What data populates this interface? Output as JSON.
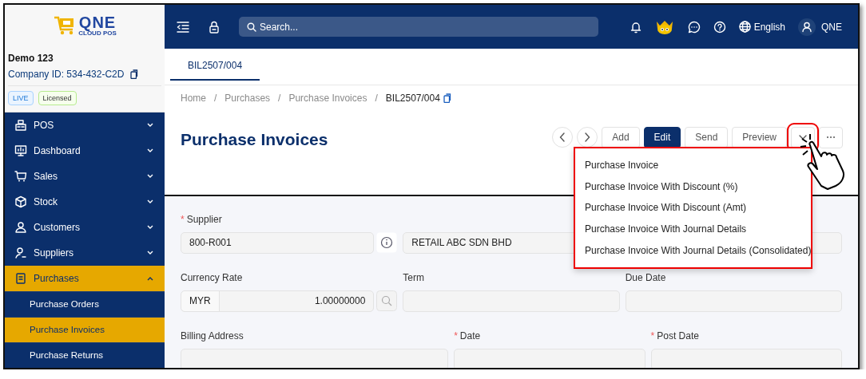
{
  "logo": {
    "name": "QNE",
    "tagline": "CLOUD POS"
  },
  "topbar": {
    "search": {
      "placeholder": "Search..."
    },
    "language": "English",
    "user": "QNE"
  },
  "company": {
    "name": "Demo 123",
    "id": "Company ID: 534-432-C2D",
    "badges": [
      {
        "label": "LIVE",
        "kind": "live"
      },
      {
        "label": "Licensed",
        "kind": "licensed"
      }
    ]
  },
  "sidebar": {
    "items": [
      {
        "label": "POS",
        "selected": false,
        "expanded": false
      },
      {
        "label": "Dashboard",
        "selected": false,
        "expanded": false
      },
      {
        "label": "Sales",
        "selected": false,
        "expanded": false
      },
      {
        "label": "Stock",
        "selected": false,
        "expanded": false
      },
      {
        "label": "Customers",
        "selected": false,
        "expanded": false
      },
      {
        "label": "Suppliers",
        "selected": false,
        "expanded": false
      },
      {
        "label": "Purchases",
        "selected": true,
        "expanded": true,
        "children": [
          {
            "label": "Purchase Orders",
            "selected": false
          },
          {
            "label": "Purchase Invoices",
            "selected": true
          },
          {
            "label": "Purchase Returns",
            "selected": false
          }
        ]
      }
    ]
  },
  "tabs": [
    {
      "label": "BIL2507/004",
      "selected": true
    }
  ],
  "breadcrumb": [
    {
      "label": "Home",
      "separator": "/"
    },
    {
      "label": "Purchases",
      "separator": "/"
    },
    {
      "label": "Purchase Invoices",
      "separator": "/"
    },
    {
      "label": "BIL2507/004"
    }
  ],
  "page_title": "Purchase Invoices",
  "toolbar": {
    "buttons": [
      {
        "kind": "prev",
        "highlighted": false
      },
      {
        "kind": "next",
        "highlighted": false
      },
      {
        "kind": "plain",
        "label": "Add",
        "highlighted": false
      },
      {
        "kind": "primary",
        "label": "Edit",
        "highlighted": false
      },
      {
        "kind": "plain",
        "label": "Send",
        "highlighted": false
      },
      {
        "kind": "plain",
        "label": "Preview",
        "highlighted": false
      },
      {
        "kind": "caret",
        "highlighted": true
      },
      {
        "kind": "more",
        "highlighted": false
      }
    ]
  },
  "print_menu": {
    "open": true,
    "highlighted": true,
    "items": [
      "Purchase Invoice",
      "Purchase Invoice With Discount (%)",
      "Purchase Invoice With Discount (Amt)",
      "Purchase Invoice With Journal Details",
      "Purchase Invoice With Journal Details (Consolidated)"
    ]
  },
  "form": {
    "rows": [
      {
        "fields": [
          {
            "kind": "lookup",
            "label": "Supplier",
            "required_mark": "*",
            "value": "800-R001"
          },
          {
            "kind": "text",
            "value": "RETAIL ABC SDN BHD"
          },
          {
            "kind": "text"
          }
        ]
      },
      {
        "fields": [
          {
            "kind": "currency",
            "label": "Currency Rate",
            "currency": "MYR",
            "value": "1.00000000"
          },
          {
            "kind": "text",
            "label": "Term"
          },
          {
            "kind": "text",
            "label": "Due Date"
          }
        ]
      },
      {
        "fields": [
          {
            "kind": "text",
            "label": "Billing Address"
          },
          {
            "kind": "text",
            "label": "Date",
            "required_mark": "*"
          },
          {
            "kind": "text",
            "label": "Post Date",
            "required_mark": "*"
          }
        ]
      }
    ]
  },
  "pointer": {
    "kind": "hand"
  }
}
